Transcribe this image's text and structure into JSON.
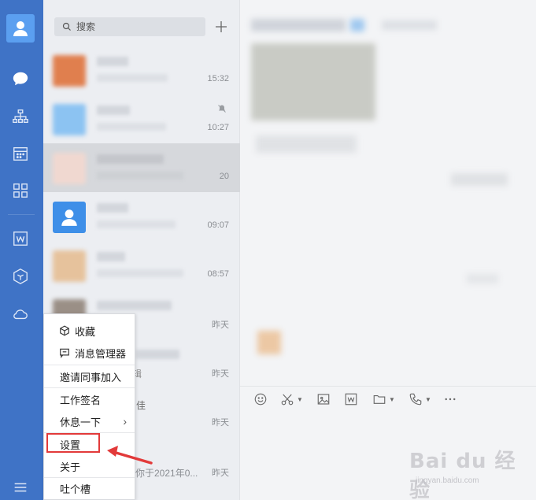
{
  "search": {
    "placeholder": "搜索"
  },
  "conversations": [
    {
      "time": "15:32"
    },
    {
      "time": "10:27"
    },
    {
      "time": "20"
    },
    {
      "time": "09:07"
    },
    {
      "time": "08:57"
    },
    {
      "time": "昨天"
    },
    {
      "time": "昨天"
    },
    {
      "time": "昨天"
    },
    {
      "time": "昨天"
    },
    {
      "time": "昨天"
    }
  ],
  "partial_text": {
    "row7_name_tail": "辑",
    "row8_name_tail": "佳",
    "row10_preview_tail": "你于2021年0..."
  },
  "menu": {
    "favorites": "收藏",
    "message_manager": "消息管理器",
    "invite": "邀请同事加入",
    "signature": "工作签名",
    "rest": "休息一下",
    "settings": "设置",
    "about": "关于",
    "feedback": "吐个槽"
  },
  "watermark": {
    "text": "Bai du 经验",
    "sub": "jingyan.baidu.com"
  },
  "colors": {
    "nav": "#3f73c6",
    "highlight": "#e23a3a",
    "avatar": "#3e8fe8"
  }
}
